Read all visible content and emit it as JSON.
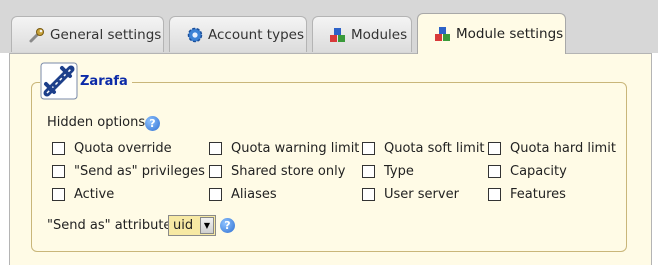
{
  "tabs": [
    {
      "label": "General settings",
      "icon": "wrench-icon"
    },
    {
      "label": "Account types",
      "icon": "gear-icon"
    },
    {
      "label": "Modules",
      "icon": "modules-icon"
    },
    {
      "label": "Module settings",
      "icon": "modules-icon",
      "active": true
    }
  ],
  "section": {
    "title": "Zarafa",
    "icon": "zarafa-logo-icon"
  },
  "hidden_options": {
    "label": "Hidden options",
    "options": [
      [
        "Quota override",
        "Quota warning limit",
        "Quota soft limit",
        "Quota hard limit"
      ],
      [
        "\"Send as\" privileges",
        "Shared store only",
        "Type",
        "Capacity"
      ],
      [
        "Active",
        "Aliases",
        "User server",
        "Features"
      ]
    ]
  },
  "send_as": {
    "label": "\"Send as\" attribute",
    "value": "uid"
  },
  "colors": {
    "panel_bg": "#fffbe6",
    "legend_title": "#0b2aa8",
    "select_bg": "#f7e9a4"
  }
}
